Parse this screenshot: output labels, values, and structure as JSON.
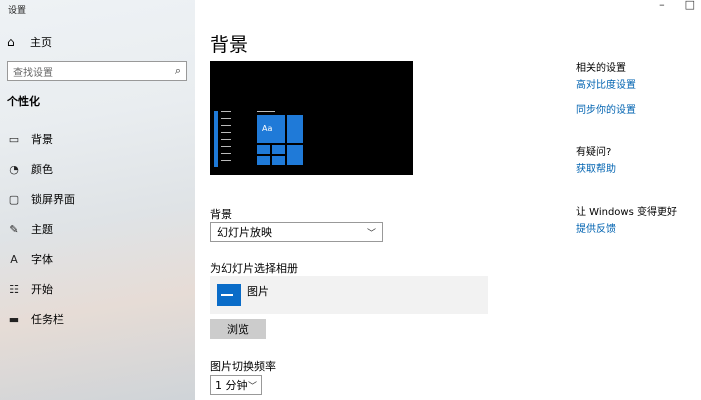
{
  "window": {
    "title": "设置",
    "minimize": "–",
    "maximize": "□"
  },
  "sidebar": {
    "home_label": "主页",
    "search_placeholder": "查找设置",
    "section_title": "个性化",
    "items": [
      {
        "label": "背景",
        "icon": "image-icon"
      },
      {
        "label": "颜色",
        "icon": "palette-icon"
      },
      {
        "label": "锁屏界面",
        "icon": "lock-screen-icon"
      },
      {
        "label": "主题",
        "icon": "theme-icon"
      },
      {
        "label": "字体",
        "icon": "font-icon"
      },
      {
        "label": "开始",
        "icon": "start-icon"
      },
      {
        "label": "任务栏",
        "icon": "taskbar-icon"
      }
    ]
  },
  "main": {
    "title": "背景",
    "preview_tile_text": "Aa",
    "background_label": "背景",
    "background_value": "幻灯片放映",
    "album_label": "为幻灯片选择相册",
    "album_name": "图片",
    "browse_label": "浏览",
    "interval_label": "图片切换频率",
    "interval_value": "1 分钟"
  },
  "right": {
    "related_title": "相关的设置",
    "link_contrast": "高对比度设置",
    "link_sync": "同步你的设置",
    "question_title": "有疑问?",
    "link_help": "获取帮助",
    "improve_title": "让 Windows 变得更好",
    "link_feedback": "提供反馈"
  },
  "colors": {
    "accent": "#1f7ad8",
    "link": "#0063b1"
  }
}
